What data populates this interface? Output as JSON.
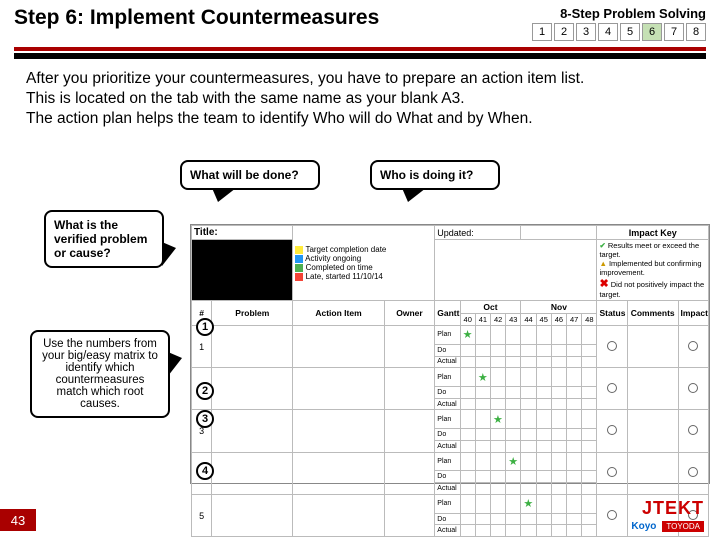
{
  "header": {
    "title": "Step 6: Implement Countermeasures",
    "brand": "8-Step Problem Solving",
    "steps": [
      "1",
      "2",
      "3",
      "4",
      "5",
      "6",
      "7",
      "8"
    ],
    "active_step": 6
  },
  "body": {
    "p1": "After you prioritize your countermeasures, you have to prepare an action item list.",
    "p2": "This is located on the tab with the same name as your blank A3.",
    "p3": "The action plan helps the team to identify Who will do What and by When."
  },
  "callouts": {
    "c1": "What will be done?",
    "c2": "Who is doing it?",
    "c3": "What is the verified problem or cause?",
    "c4": "Use the numbers from your big/easy matrix to identify which countermeasures match which root causes."
  },
  "sheet": {
    "title_label": "Title:",
    "updated_label": "Updated:",
    "impact_key": "Impact Key",
    "legend": {
      "l1": "Target completion date",
      "l2": "Activity ongoing",
      "l3": "Completed on time",
      "l4": "Late, started 11/10/14"
    },
    "impact": {
      "i1": "Results meet or exceed the target.",
      "i2": "Implemented but confirming improvement.",
      "i3": "Did not positively impact the target."
    },
    "cols": {
      "num": "#",
      "problem": "Problem",
      "action": "Action Item",
      "owner": "Owner",
      "gantt": "Gantt",
      "oct": "Oct",
      "nov": "Nov",
      "status": "Status",
      "comments": "Comments",
      "impact": "Impact"
    },
    "weeks": [
      "40",
      "41",
      "42",
      "43",
      "44",
      "45",
      "46",
      "47",
      "48"
    ],
    "row_sub": {
      "plan": "Plan",
      "do": "Do",
      "actual": "Actual"
    },
    "rows": [
      "1",
      "2",
      "3",
      "4",
      "5"
    ],
    "circled": [
      "1",
      "2",
      "3",
      "4"
    ]
  },
  "footer": {
    "page": "43",
    "brand1": "JTEKT",
    "brand2": "Koyo",
    "brand3": "TOYODA"
  }
}
